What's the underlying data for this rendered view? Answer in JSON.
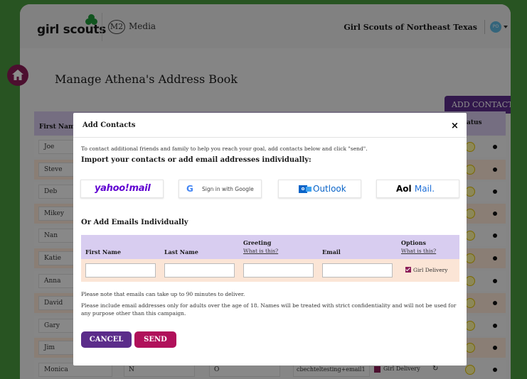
{
  "header": {
    "logo_text": "girl scouts",
    "m2_badge": "M2",
    "media_label": "Media",
    "council_name": "Girl Scouts of Northeast Texas",
    "avatar_initials": "PO"
  },
  "page": {
    "title": "Manage Athena's Address Book",
    "add_contacts_label": "ADD CONTACTS",
    "column_first_name": "First Name",
    "column_status_partial": "atus"
  },
  "contacts": [
    {
      "first": "Joe"
    },
    {
      "first": "Steve"
    },
    {
      "first": "Deb"
    },
    {
      "first": "Mikey"
    },
    {
      "first": "Nan"
    },
    {
      "first": "Katie"
    },
    {
      "first": "Anna"
    },
    {
      "first": "David"
    },
    {
      "first": "Gary"
    },
    {
      "first": "Jim"
    },
    {
      "first": "Monica",
      "last": "N",
      "greeting": "O",
      "email": "cbechteltesting+email1",
      "option": "Girl Delivery"
    }
  ],
  "modal": {
    "title": "Add Contacts",
    "close_glyph": "×",
    "intro": "To contact additional friends and family to help you reach your goal, add contacts below and click \"send\".",
    "import_heading": "Import your contacts or add email addresses individually:",
    "providers": {
      "yahoo": "yahoo!mail",
      "google": "Sign in with Google",
      "outlook": "Outlook",
      "aol": "Aol",
      "aol_mail": "Mail."
    },
    "or_heading": "Or Add Emails Individually",
    "form": {
      "first_name": "First Name",
      "last_name": "Last Name",
      "greeting": "Greeting",
      "greeting_link": "What is this?",
      "email": "Email",
      "options": "Options",
      "options_link": "What is this?",
      "girl_delivery": "Girl Delivery",
      "girl_delivery_checked": true
    },
    "note1": "Please note that emails can take up to 90 minutes to deliver.",
    "note2": "Please include email addresses only for adults over the age of 18. Names will be treated with strict confidentiality and will not be used for any purpose other than this campaign.",
    "cancel_label": "CANCEL",
    "send_label": "SEND"
  },
  "colors": {
    "background_green": "#4a9a3e",
    "purple": "#5b2c8a",
    "magenta": "#b0105a",
    "home_badge": "#8b1d57",
    "header_row": "#d8cdf0",
    "form_row": "#fbe5d6"
  },
  "icons": [
    "trefoil-icon",
    "home-icon",
    "google-g-icon",
    "outlook-icon",
    "close-icon",
    "refresh-icon",
    "status-dot-icon"
  ]
}
